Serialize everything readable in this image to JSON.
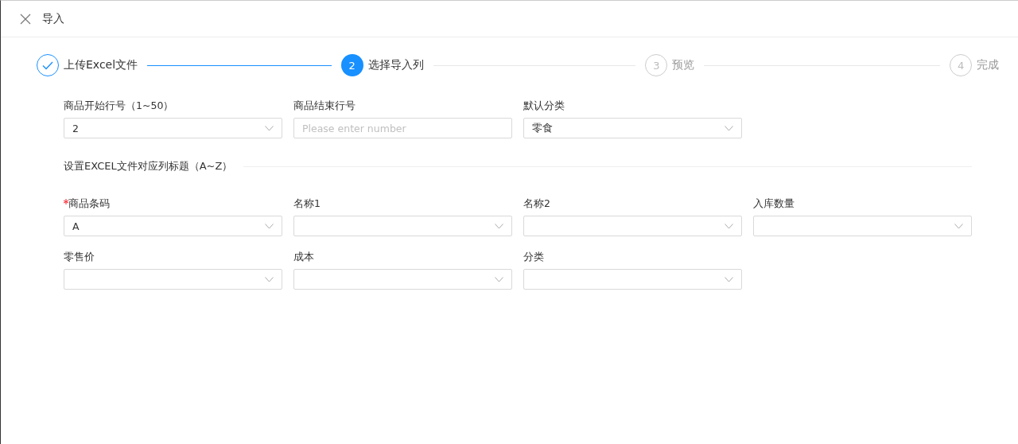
{
  "dialog": {
    "title": "导入"
  },
  "steps": [
    {
      "title": "上传Excel文件",
      "done": true,
      "selected": false
    },
    {
      "number": "2",
      "title": "选择导入列",
      "done": false,
      "selected": true
    },
    {
      "number": "3",
      "title": "预览",
      "done": false,
      "selected": false
    },
    {
      "number": "4",
      "title": "完成",
      "done": false,
      "selected": false
    }
  ],
  "basic_fields": [
    {
      "kind": "select",
      "label": "商品开始行号（1~50）",
      "required": false,
      "value": "2"
    },
    {
      "kind": "input",
      "label": "商品结束行号",
      "required": false,
      "placeholder": "Please enter number"
    },
    {
      "kind": "select",
      "label": "默认分类",
      "required": false,
      "value": "零食"
    }
  ],
  "section": {
    "title": "设置EXCEL文件对应列标题（A~Z）"
  },
  "column_fields": [
    {
      "kind": "select",
      "label": "商品条码",
      "required": true,
      "value": "A"
    },
    {
      "kind": "select",
      "label": "名称1",
      "required": false
    },
    {
      "kind": "select",
      "label": "名称2",
      "required": false
    },
    {
      "kind": "select",
      "label": "入库数量",
      "required": false
    },
    {
      "kind": "select",
      "label": "零售价",
      "required": false
    },
    {
      "kind": "select",
      "label": "成本",
      "required": false
    },
    {
      "kind": "select",
      "label": "分类",
      "required": false
    }
  ]
}
